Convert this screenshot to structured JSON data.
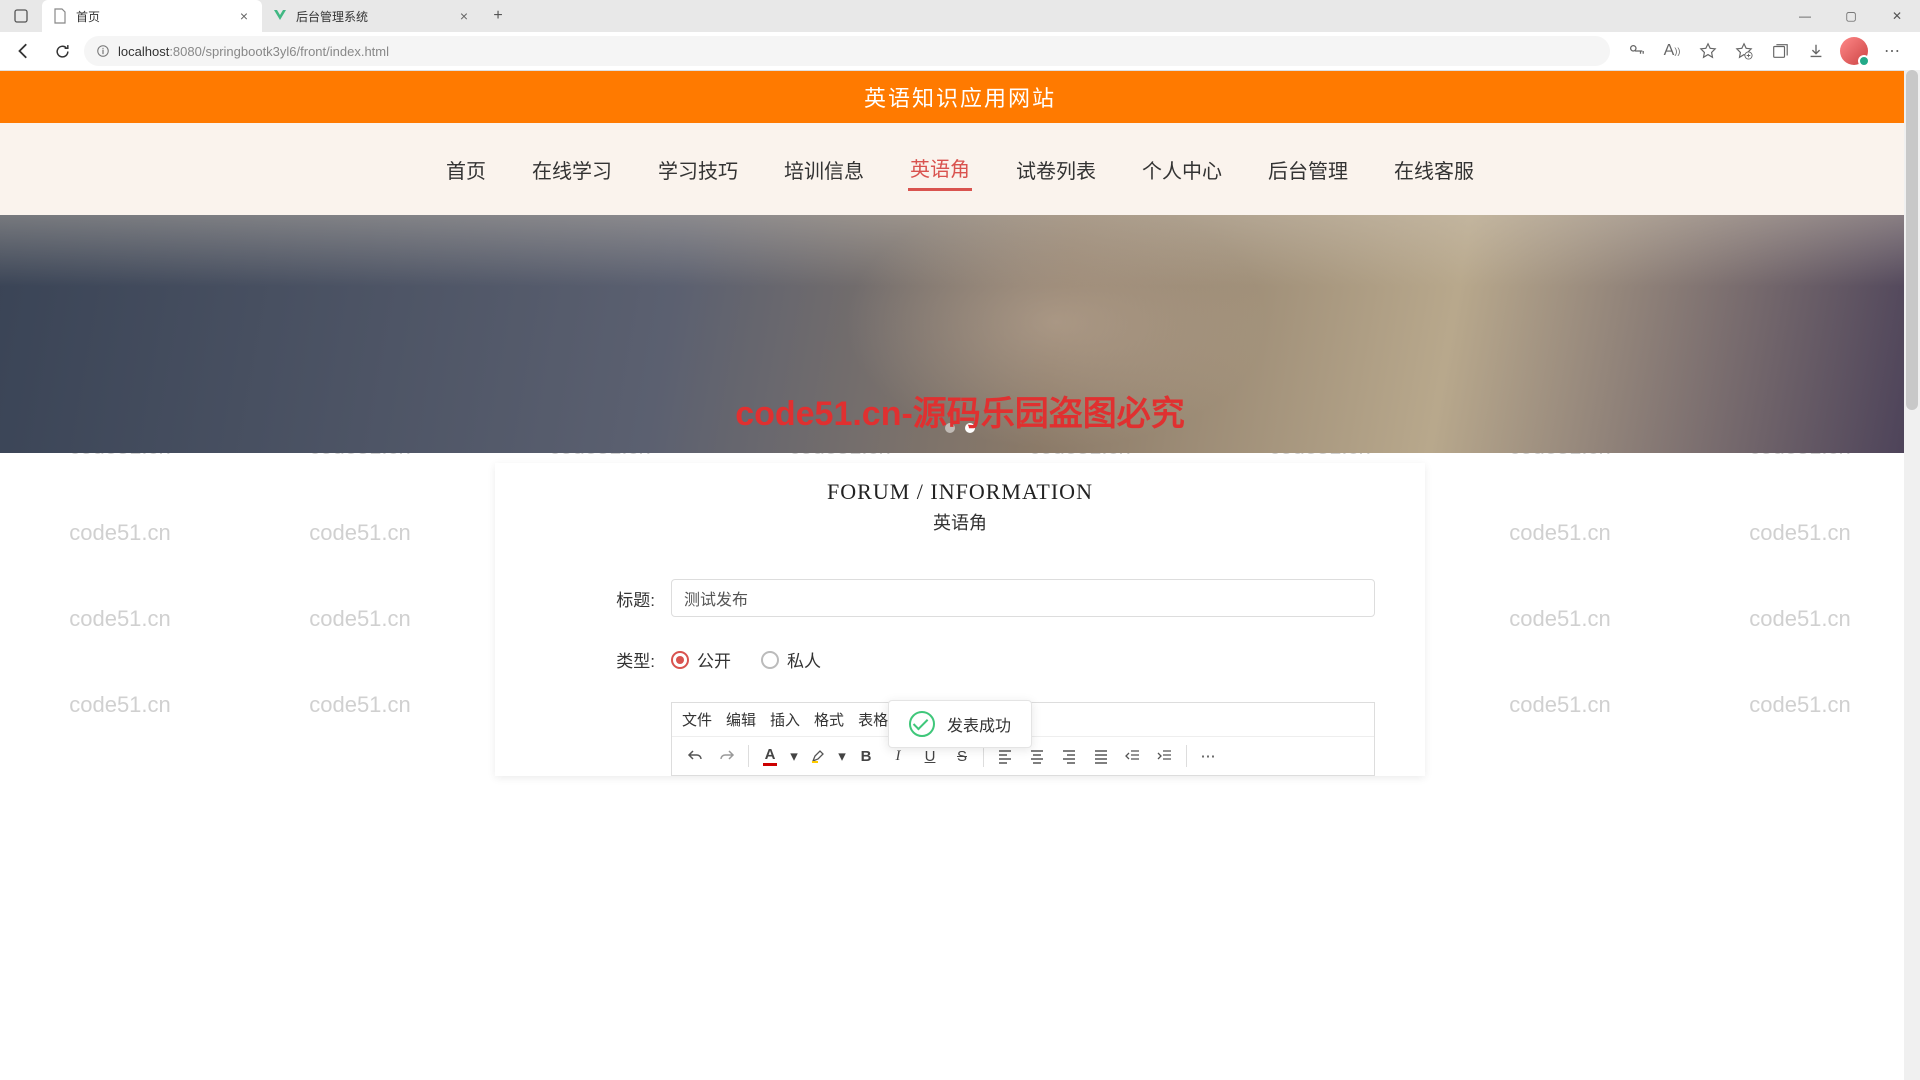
{
  "browser": {
    "tabs": [
      {
        "title": "首页",
        "active": true
      },
      {
        "title": "后台管理系统",
        "active": false
      }
    ],
    "url_host": "localhost",
    "url_port": ":8080",
    "url_path": "/springbootk3yl6/front/index.html"
  },
  "watermark_text": "code51.cn",
  "site": {
    "title": "英语知识应用网站",
    "nav": [
      "首页",
      "在线学习",
      "学习技巧",
      "培训信息",
      "英语角",
      "试卷列表",
      "个人中心",
      "后台管理",
      "在线客服"
    ],
    "nav_active_index": 4
  },
  "banner": {
    "overlay_text": "code51.cn-源码乐园盗图必究"
  },
  "section": {
    "title_en": "FORUM / INFORMATION",
    "title_cn": "英语角"
  },
  "form": {
    "title_label": "标题:",
    "title_value": "测试发布",
    "type_label": "类型:",
    "type_options": [
      "公开",
      "私人"
    ],
    "type_selected_index": 0
  },
  "editor": {
    "menu": [
      "文件",
      "编辑",
      "插入",
      "格式",
      "表格"
    ]
  },
  "toast": {
    "message": "发表成功"
  }
}
